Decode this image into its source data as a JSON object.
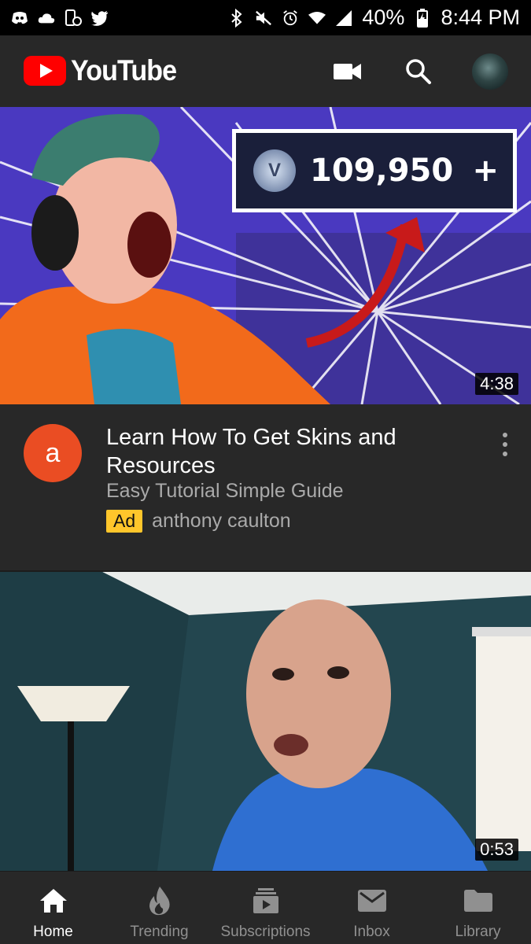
{
  "status_bar": {
    "battery": "40%",
    "time": "8:44 PM"
  },
  "app_bar": {
    "logo_text": "YouTube"
  },
  "videos": [
    {
      "coin_counter": "109,950",
      "coin_plus": "+",
      "duration": "4:38",
      "channel_initial": "a",
      "title": "Learn How To Get Skins and Resources",
      "subtitle": "Easy Tutorial Simple Guide",
      "ad_label": "Ad",
      "advertiser": "anthony caulton"
    },
    {
      "duration": "0:53"
    }
  ],
  "bottom_nav": [
    {
      "label": "Home",
      "icon": "home-icon"
    },
    {
      "label": "Trending",
      "icon": "flame-icon"
    },
    {
      "label": "Subscriptions",
      "icon": "subscriptions-icon"
    },
    {
      "label": "Inbox",
      "icon": "mail-icon"
    },
    {
      "label": "Library",
      "icon": "folder-icon"
    }
  ],
  "colors": {
    "brand_red": "#ff0000",
    "ad_yellow": "#ffc62b",
    "channel_avatar": "#ea4d23",
    "background": "#282828"
  }
}
